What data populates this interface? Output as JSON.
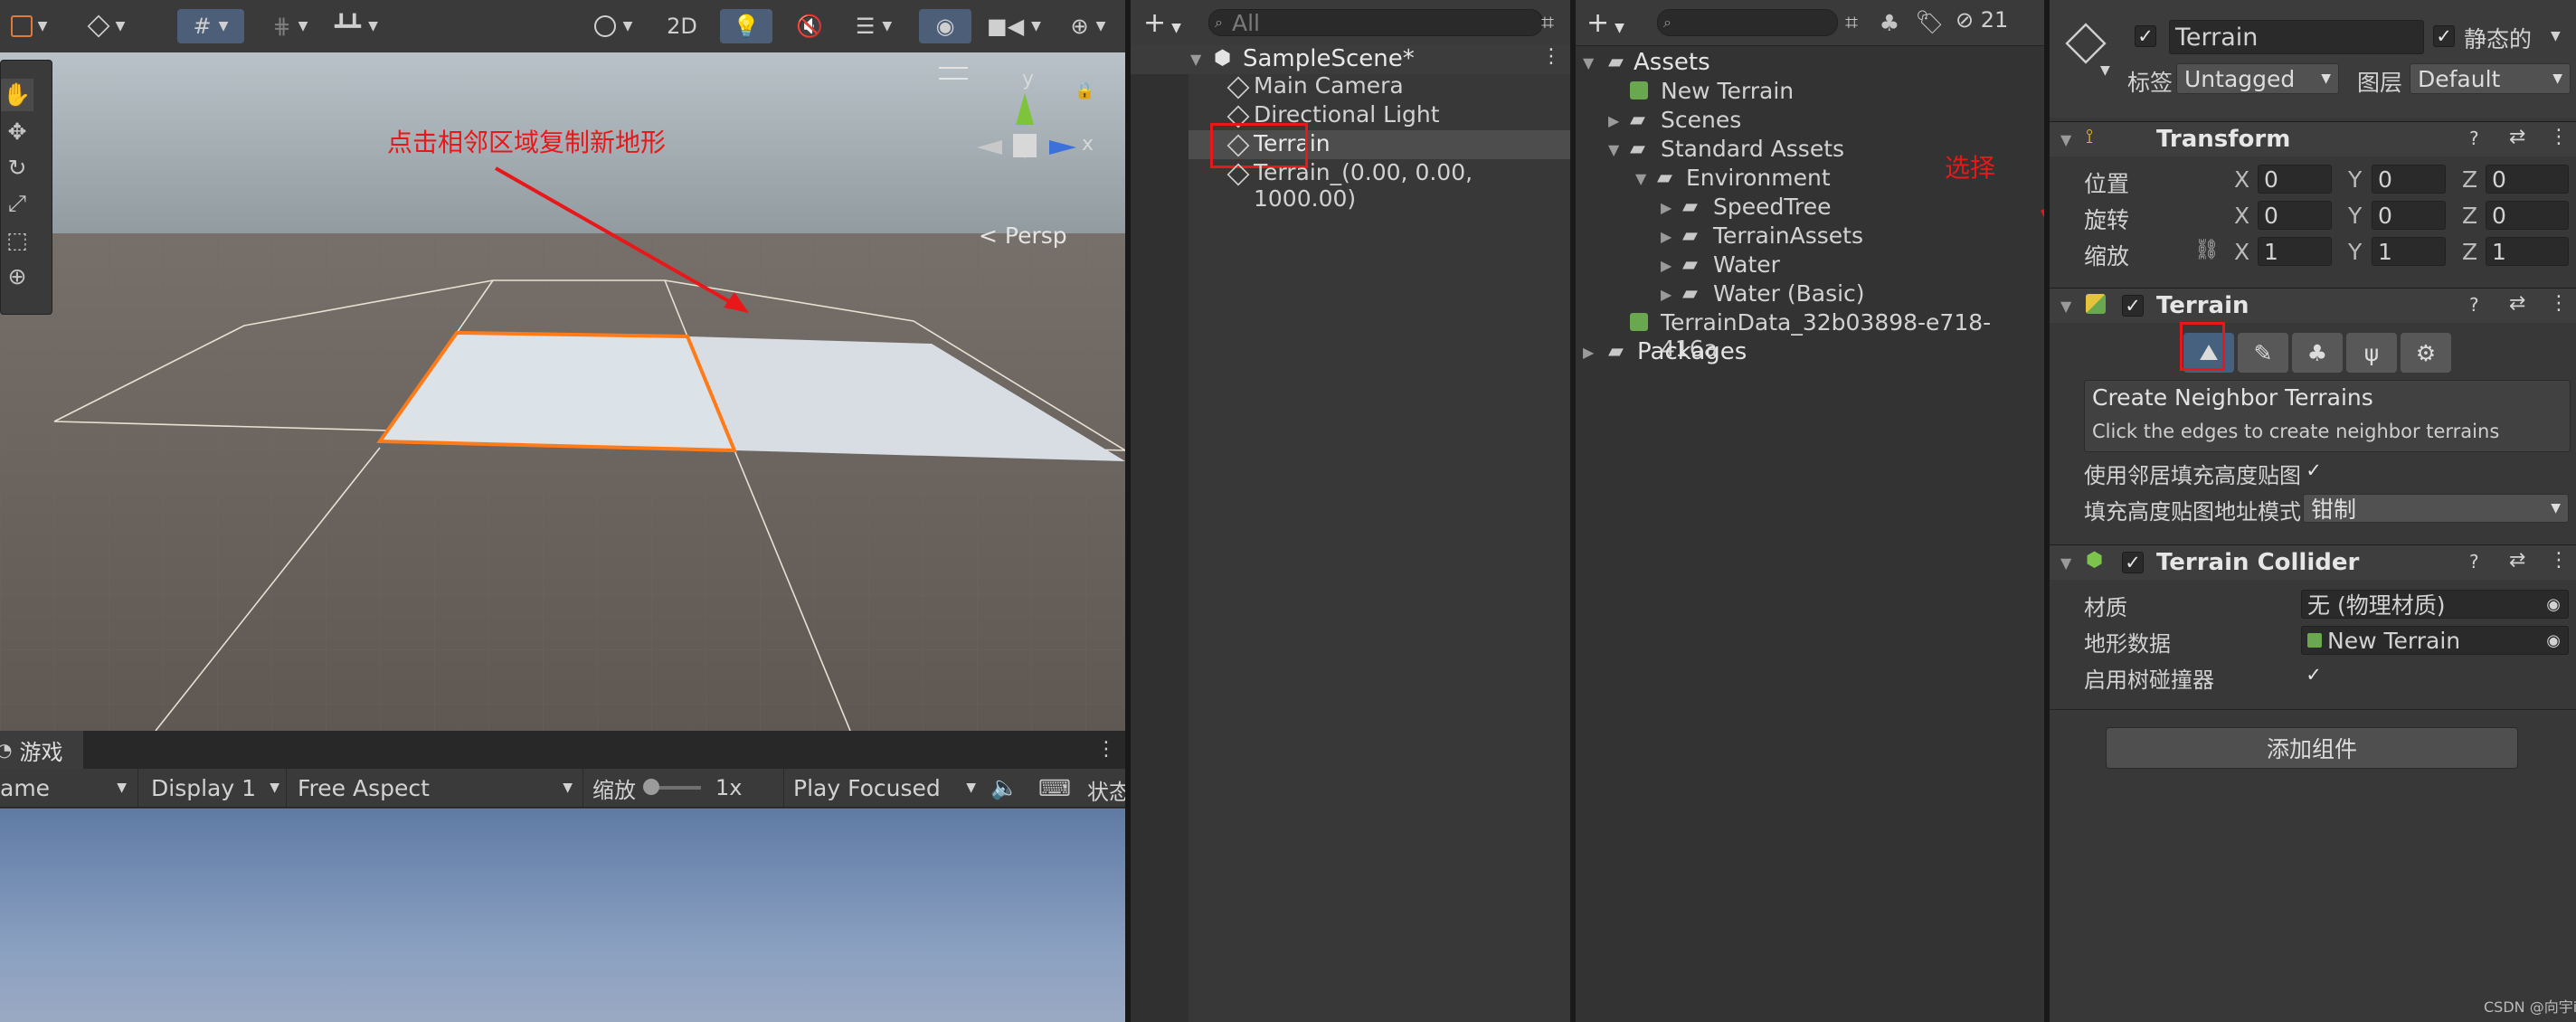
{
  "scene_view": {
    "btn_2d": "2D",
    "persp_label": "< Persp",
    "gizmo_axes": {
      "y": "y",
      "x": "x"
    },
    "annotation_text": "点击相邻区域复制新地形"
  },
  "game_view": {
    "tab_label": "游戏",
    "game_fragment": "ame",
    "display": "Display 1",
    "aspect": "Free Aspect",
    "scale_label": "缩放",
    "scale_value": "1x",
    "play_mode": "Play Focused",
    "stats_fragment": "状态"
  },
  "hierarchy": {
    "search_placeholder": "All",
    "scene_name": "SampleScene*",
    "items": [
      {
        "label": "Main Camera"
      },
      {
        "label": "Directional Light"
      },
      {
        "label": "Terrain"
      },
      {
        "label": "Terrain_(0.00, 0.00, 1000.00)"
      }
    ]
  },
  "project": {
    "hidden_count": "21",
    "tree": [
      {
        "label": "Assets"
      },
      {
        "label": "New Terrain"
      },
      {
        "label": "Scenes"
      },
      {
        "label": "Standard Assets"
      },
      {
        "label": "Environment"
      },
      {
        "label": "SpeedTree"
      },
      {
        "label": "TerrainAssets"
      },
      {
        "label": "Water"
      },
      {
        "label": "Water (Basic)"
      },
      {
        "label": "TerrainData_32b03898-e718-416a"
      },
      {
        "label": "Packages"
      }
    ],
    "annotation_text": "选择"
  },
  "inspector": {
    "object_name": "Terrain",
    "static_label": "静态的",
    "tag_label": "标签",
    "tag_value": "Untagged",
    "layer_label": "图层",
    "layer_value": "Default",
    "transform": {
      "title": "Transform",
      "position_label": "位置",
      "rotation_label": "旋转",
      "scale_label": "缩放",
      "position": {
        "x": "0",
        "y": "0",
        "z": "0"
      },
      "rotation": {
        "x": "0",
        "y": "0",
        "z": "0"
      },
      "scale": {
        "x": "1",
        "y": "1",
        "z": "1"
      },
      "axis_x": "X",
      "axis_y": "Y",
      "axis_z": "Z"
    },
    "terrain": {
      "title": "Terrain",
      "neighbor_title": "Create Neighbor Terrains",
      "neighbor_desc": "Click the edges to create neighbor terrains",
      "fill_heightmap_label": "使用邻居填充高度贴图",
      "address_mode_label": "填充高度贴图地址模式",
      "address_mode_value": "钳制"
    },
    "collider": {
      "title": "Terrain Collider",
      "material_label": "材质",
      "material_value": "无 (物理材质)",
      "terrain_data_label": "地形数据",
      "terrain_data_value": "New Terrain",
      "tree_colliders_label": "启用树碰撞器"
    },
    "add_component": "添加组件"
  },
  "watermark": "CSDN @向宇it",
  "colors": {
    "annotation_red": "#e8181a",
    "terrain_select_orange": "#ff7a18",
    "panel_bg": "#383838",
    "scene_ground": "#6a625a",
    "scene_sky": "#9aa6ad",
    "accent_blue": "#3c5f8c"
  }
}
